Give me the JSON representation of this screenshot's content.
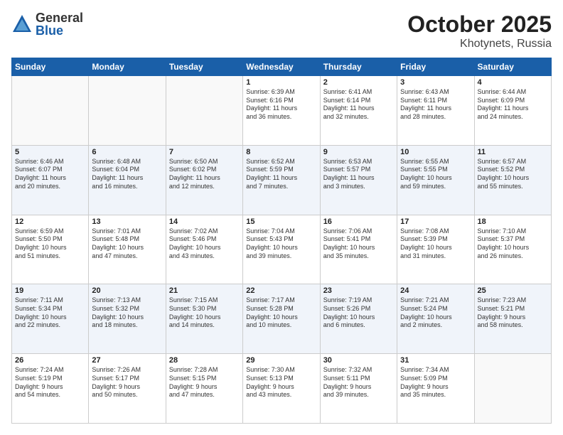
{
  "header": {
    "logo_general": "General",
    "logo_blue": "Blue",
    "month": "October 2025",
    "location": "Khotynets, Russia"
  },
  "weekdays": [
    "Sunday",
    "Monday",
    "Tuesday",
    "Wednesday",
    "Thursday",
    "Friday",
    "Saturday"
  ],
  "weeks": [
    [
      {
        "day": "",
        "text": ""
      },
      {
        "day": "",
        "text": ""
      },
      {
        "day": "",
        "text": ""
      },
      {
        "day": "1",
        "text": "Sunrise: 6:39 AM\nSunset: 6:16 PM\nDaylight: 11 hours\nand 36 minutes."
      },
      {
        "day": "2",
        "text": "Sunrise: 6:41 AM\nSunset: 6:14 PM\nDaylight: 11 hours\nand 32 minutes."
      },
      {
        "day": "3",
        "text": "Sunrise: 6:43 AM\nSunset: 6:11 PM\nDaylight: 11 hours\nand 28 minutes."
      },
      {
        "day": "4",
        "text": "Sunrise: 6:44 AM\nSunset: 6:09 PM\nDaylight: 11 hours\nand 24 minutes."
      }
    ],
    [
      {
        "day": "5",
        "text": "Sunrise: 6:46 AM\nSunset: 6:07 PM\nDaylight: 11 hours\nand 20 minutes."
      },
      {
        "day": "6",
        "text": "Sunrise: 6:48 AM\nSunset: 6:04 PM\nDaylight: 11 hours\nand 16 minutes."
      },
      {
        "day": "7",
        "text": "Sunrise: 6:50 AM\nSunset: 6:02 PM\nDaylight: 11 hours\nand 12 minutes."
      },
      {
        "day": "8",
        "text": "Sunrise: 6:52 AM\nSunset: 5:59 PM\nDaylight: 11 hours\nand 7 minutes."
      },
      {
        "day": "9",
        "text": "Sunrise: 6:53 AM\nSunset: 5:57 PM\nDaylight: 11 hours\nand 3 minutes."
      },
      {
        "day": "10",
        "text": "Sunrise: 6:55 AM\nSunset: 5:55 PM\nDaylight: 10 hours\nand 59 minutes."
      },
      {
        "day": "11",
        "text": "Sunrise: 6:57 AM\nSunset: 5:52 PM\nDaylight: 10 hours\nand 55 minutes."
      }
    ],
    [
      {
        "day": "12",
        "text": "Sunrise: 6:59 AM\nSunset: 5:50 PM\nDaylight: 10 hours\nand 51 minutes."
      },
      {
        "day": "13",
        "text": "Sunrise: 7:01 AM\nSunset: 5:48 PM\nDaylight: 10 hours\nand 47 minutes."
      },
      {
        "day": "14",
        "text": "Sunrise: 7:02 AM\nSunset: 5:46 PM\nDaylight: 10 hours\nand 43 minutes."
      },
      {
        "day": "15",
        "text": "Sunrise: 7:04 AM\nSunset: 5:43 PM\nDaylight: 10 hours\nand 39 minutes."
      },
      {
        "day": "16",
        "text": "Sunrise: 7:06 AM\nSunset: 5:41 PM\nDaylight: 10 hours\nand 35 minutes."
      },
      {
        "day": "17",
        "text": "Sunrise: 7:08 AM\nSunset: 5:39 PM\nDaylight: 10 hours\nand 31 minutes."
      },
      {
        "day": "18",
        "text": "Sunrise: 7:10 AM\nSunset: 5:37 PM\nDaylight: 10 hours\nand 26 minutes."
      }
    ],
    [
      {
        "day": "19",
        "text": "Sunrise: 7:11 AM\nSunset: 5:34 PM\nDaylight: 10 hours\nand 22 minutes."
      },
      {
        "day": "20",
        "text": "Sunrise: 7:13 AM\nSunset: 5:32 PM\nDaylight: 10 hours\nand 18 minutes."
      },
      {
        "day": "21",
        "text": "Sunrise: 7:15 AM\nSunset: 5:30 PM\nDaylight: 10 hours\nand 14 minutes."
      },
      {
        "day": "22",
        "text": "Sunrise: 7:17 AM\nSunset: 5:28 PM\nDaylight: 10 hours\nand 10 minutes."
      },
      {
        "day": "23",
        "text": "Sunrise: 7:19 AM\nSunset: 5:26 PM\nDaylight: 10 hours\nand 6 minutes."
      },
      {
        "day": "24",
        "text": "Sunrise: 7:21 AM\nSunset: 5:24 PM\nDaylight: 10 hours\nand 2 minutes."
      },
      {
        "day": "25",
        "text": "Sunrise: 7:23 AM\nSunset: 5:21 PM\nDaylight: 9 hours\nand 58 minutes."
      }
    ],
    [
      {
        "day": "26",
        "text": "Sunrise: 7:24 AM\nSunset: 5:19 PM\nDaylight: 9 hours\nand 54 minutes."
      },
      {
        "day": "27",
        "text": "Sunrise: 7:26 AM\nSunset: 5:17 PM\nDaylight: 9 hours\nand 50 minutes."
      },
      {
        "day": "28",
        "text": "Sunrise: 7:28 AM\nSunset: 5:15 PM\nDaylight: 9 hours\nand 47 minutes."
      },
      {
        "day": "29",
        "text": "Sunrise: 7:30 AM\nSunset: 5:13 PM\nDaylight: 9 hours\nand 43 minutes."
      },
      {
        "day": "30",
        "text": "Sunrise: 7:32 AM\nSunset: 5:11 PM\nDaylight: 9 hours\nand 39 minutes."
      },
      {
        "day": "31",
        "text": "Sunrise: 7:34 AM\nSunset: 5:09 PM\nDaylight: 9 hours\nand 35 minutes."
      },
      {
        "day": "",
        "text": ""
      }
    ]
  ]
}
